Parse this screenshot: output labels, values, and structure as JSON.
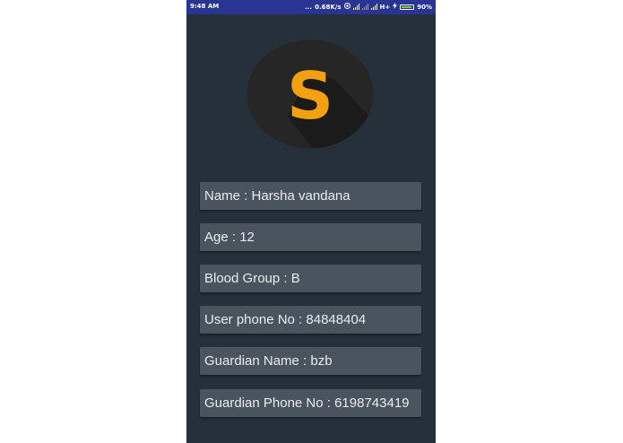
{
  "statusbar": {
    "time": "9:48 AM",
    "dots": "...",
    "speed": "0.68K/s",
    "network": "H+",
    "battery": "90%",
    "battery_level": 0.9
  },
  "profile": {
    "logo_letter": "S",
    "logo_bg": "#262626",
    "logo_color": "#f5a011",
    "fields": [
      {
        "text": "Name : Harsha vandana"
      },
      {
        "text": "Age : 12"
      },
      {
        "text": "Blood Group : B"
      },
      {
        "text": "User phone No : 84848404"
      },
      {
        "text": "Guardian Name : bzb"
      },
      {
        "text": "Guardian Phone No : 6198743419"
      }
    ]
  },
  "colors": {
    "screen_bg": "#25303a",
    "field_bg": "#4a545e",
    "field_text": "#e8ecef",
    "statusbar_bg": "#283593"
  }
}
